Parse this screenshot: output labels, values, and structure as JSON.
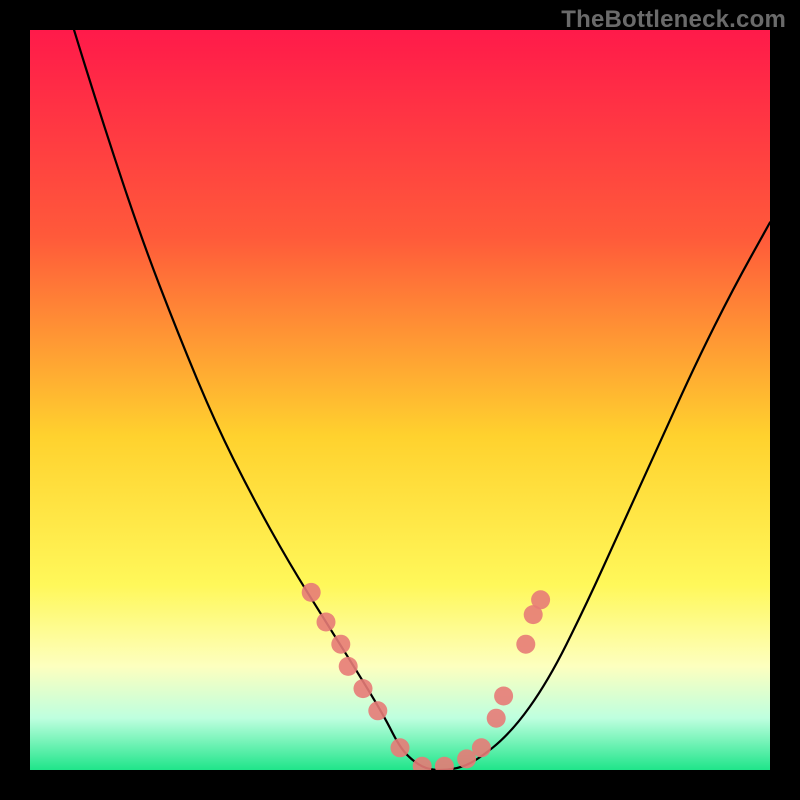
{
  "watermark": "TheBottleneck.com",
  "chart_data": {
    "type": "line",
    "title": "",
    "xlabel": "",
    "ylabel": "",
    "xlim": [
      0,
      100
    ],
    "ylim": [
      0,
      100
    ],
    "curve": {
      "name": "bottleneck-curve",
      "x": [
        0,
        5,
        10,
        15,
        20,
        25,
        30,
        35,
        40,
        45,
        48,
        50,
        52,
        54,
        57,
        60,
        65,
        70,
        75,
        80,
        85,
        90,
        95,
        100
      ],
      "y": [
        120,
        103,
        87,
        72,
        59,
        47,
        37,
        28,
        20,
        12,
        7,
        3,
        1,
        0,
        0,
        1,
        5,
        12,
        22,
        33,
        44,
        55,
        65,
        74
      ]
    },
    "highlight_points": {
      "name": "dot-highlights",
      "points": [
        {
          "x": 38,
          "y": 24
        },
        {
          "x": 40,
          "y": 20
        },
        {
          "x": 42,
          "y": 17
        },
        {
          "x": 43,
          "y": 14
        },
        {
          "x": 45,
          "y": 11
        },
        {
          "x": 47,
          "y": 8
        },
        {
          "x": 50,
          "y": 3
        },
        {
          "x": 53,
          "y": 0.5
        },
        {
          "x": 56,
          "y": 0.5
        },
        {
          "x": 59,
          "y": 1.5
        },
        {
          "x": 61,
          "y": 3
        },
        {
          "x": 63,
          "y": 7
        },
        {
          "x": 64,
          "y": 10
        },
        {
          "x": 67,
          "y": 17
        },
        {
          "x": 68,
          "y": 21
        },
        {
          "x": 69,
          "y": 23
        }
      ]
    },
    "gradient_stops": [
      {
        "offset": 0,
        "color": "#ff1a4a"
      },
      {
        "offset": 28,
        "color": "#ff5a3a"
      },
      {
        "offset": 55,
        "color": "#ffd22e"
      },
      {
        "offset": 75,
        "color": "#fff85a"
      },
      {
        "offset": 86,
        "color": "#fdffbf"
      },
      {
        "offset": 93,
        "color": "#beffdf"
      },
      {
        "offset": 100,
        "color": "#1fe58a"
      }
    ]
  }
}
